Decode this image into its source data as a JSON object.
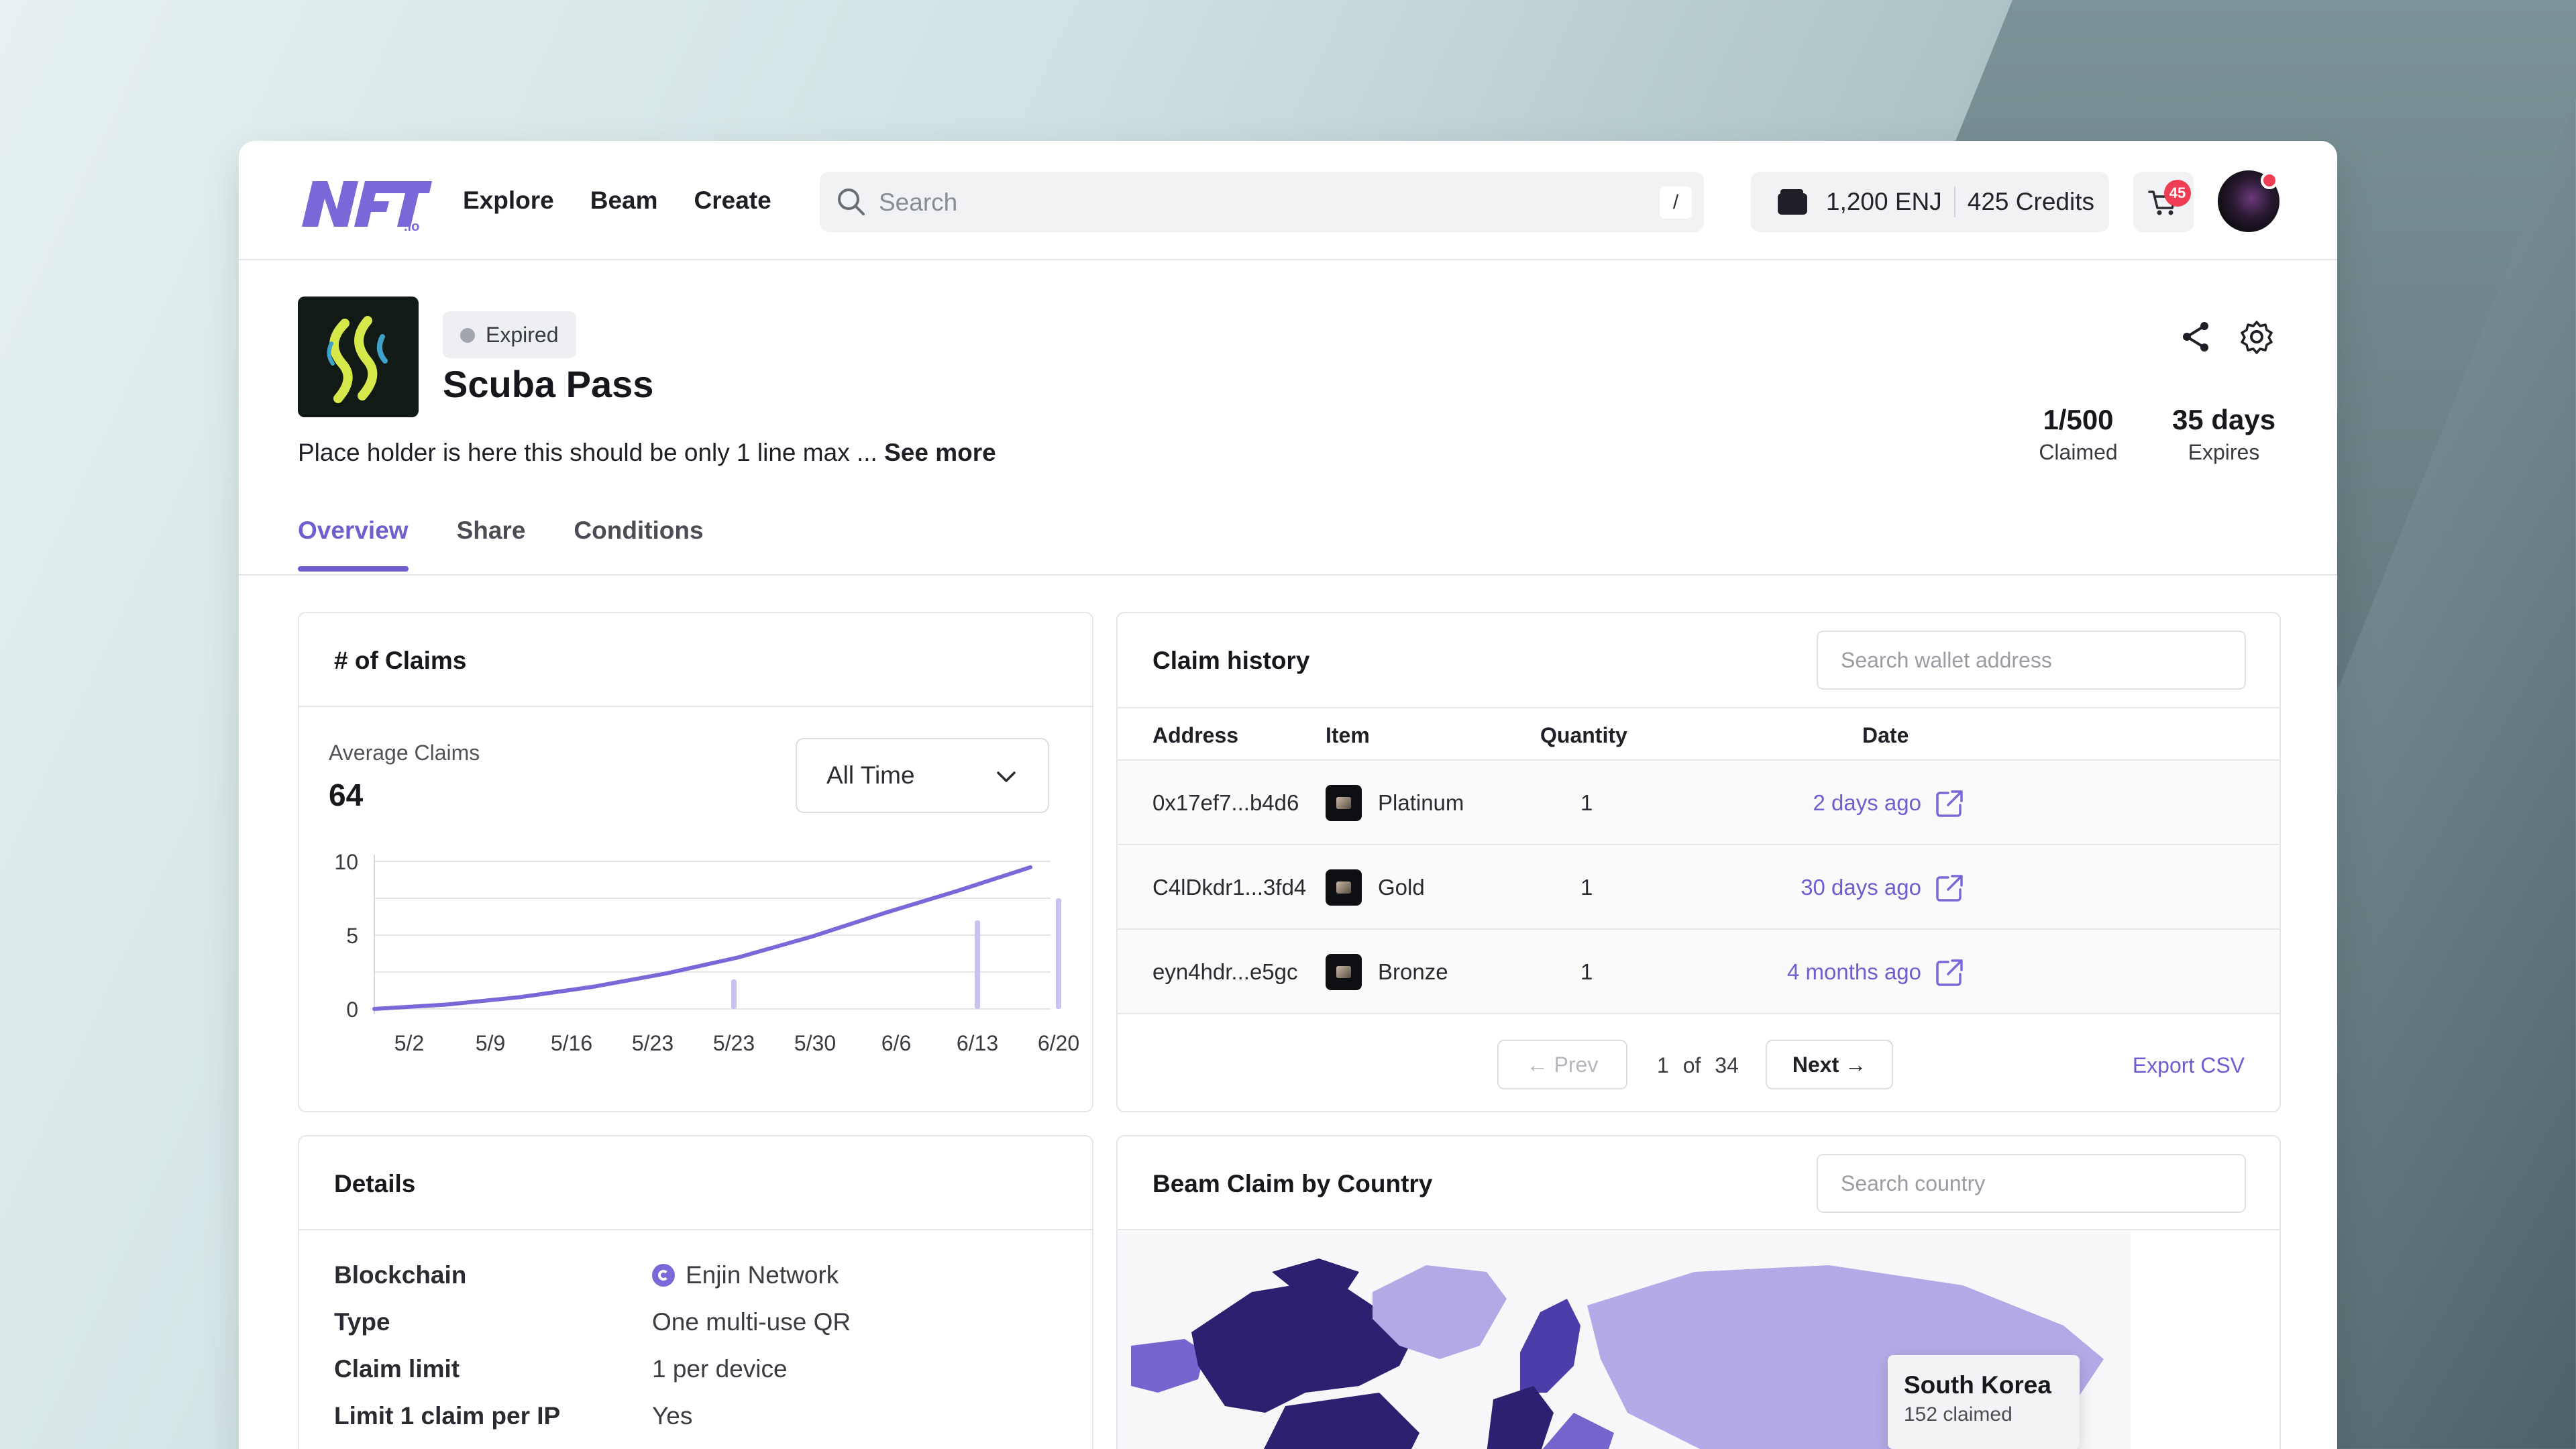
{
  "header": {
    "logo_text": "NFT.io",
    "nav": [
      "Explore",
      "Beam",
      "Create"
    ],
    "search_placeholder": "Search",
    "search_shortcut": "/",
    "balance_enj": "1,200 ENJ",
    "credits": "425 Credits",
    "cart_count": "45"
  },
  "beam": {
    "status": "Expired",
    "title": "Scuba Pass",
    "description": "Place holder is here this should be only 1 line max ...",
    "see_more": "See more",
    "claimed_value": "1/500",
    "claimed_label": "Claimed",
    "expires_value": "35 days",
    "expires_label": "Expires"
  },
  "tabs": [
    "Overview",
    "Share",
    "Conditions"
  ],
  "claims_card": {
    "title": "# of Claims",
    "avg_label": "Average Claims",
    "avg_value": "64",
    "range_select": "All Time"
  },
  "chart_data": {
    "type": "line",
    "title": "",
    "xlabel": "",
    "ylabel": "",
    "categories": [
      "5/2",
      "5/9",
      "5/16",
      "5/23",
      "5/23",
      "5/30",
      "6/6",
      "6/13",
      "6/20"
    ],
    "ylim": [
      0,
      10
    ],
    "yticks": [
      0,
      5,
      10
    ],
    "series": [
      {
        "values": [
          0,
          0.3,
          0.8,
          1.5,
          2.4,
          3.5,
          4.9,
          6.5,
          8.0,
          9.6
        ]
      }
    ],
    "spikes": [
      {
        "x_index": 4,
        "value": 2
      },
      {
        "x_index": 7,
        "value": 6
      },
      {
        "x_index": 8,
        "value": 7.5
      }
    ],
    "grid": true,
    "line_color": "#7b68d8"
  },
  "history": {
    "title": "Claim history",
    "search_placeholder": "Search wallet address",
    "columns": [
      "Address",
      "Item",
      "Quantity",
      "Date"
    ],
    "rows": [
      {
        "address": "0x17ef7...b4d6",
        "item": "Platinum",
        "qty": "1",
        "date": "2 days ago"
      },
      {
        "address": "C4lDkdr1...3fd4",
        "item": "Gold",
        "qty": "1",
        "date": "30 days ago"
      },
      {
        "address": "eyn4hdr...e5gc",
        "item": "Bronze",
        "qty": "1",
        "date": "4 months ago"
      }
    ],
    "prev": "← Prev",
    "page_info": "1 of 34",
    "next": "Next →",
    "export": "Export CSV"
  },
  "details": {
    "title": "Details",
    "rows": [
      {
        "k": "Blockchain",
        "v": "Enjin Network"
      },
      {
        "k": "Type",
        "v": "One multi-use QR"
      },
      {
        "k": "Claim limit",
        "v": "1 per device"
      },
      {
        "k": "Limit 1 claim per IP",
        "v": "Yes"
      }
    ]
  },
  "country": {
    "title": "Beam Claim by Country",
    "search_placeholder": "Search country",
    "tooltip_country": "South Korea",
    "tooltip_value": "152 claimed"
  }
}
